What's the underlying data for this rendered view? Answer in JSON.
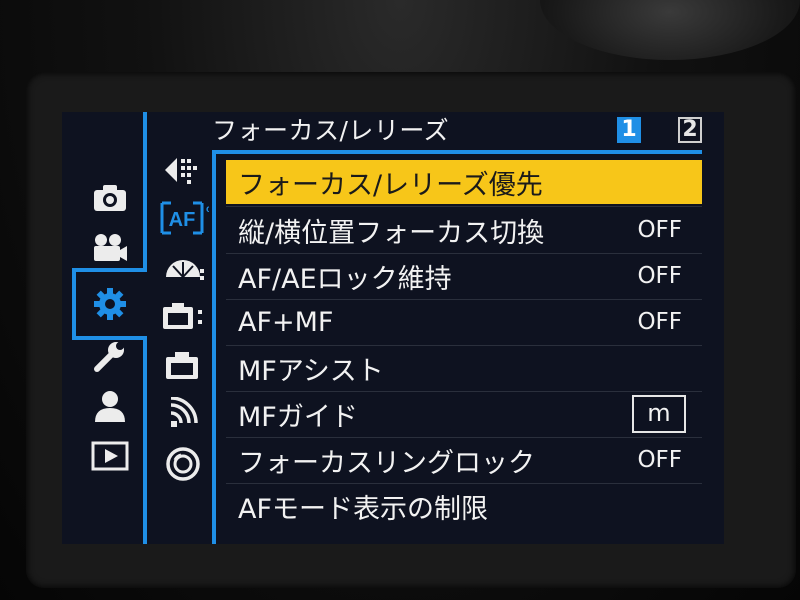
{
  "menu": {
    "title": "フォーカス/レリーズ",
    "pages": [
      "1",
      "2"
    ],
    "active_page": "1",
    "items": [
      {
        "label": "フォーカス/レリーズ優先",
        "value": "",
        "selected": true
      },
      {
        "label": "縦/横位置フォーカス切換",
        "value": "OFF"
      },
      {
        "label": "AF/AEロック維持",
        "value": "OFF"
      },
      {
        "label": "AF+MF",
        "value": "OFF"
      },
      {
        "label": "MFアシスト",
        "value": ""
      },
      {
        "label": "MFガイド",
        "value": "m"
      },
      {
        "label": "フォーカスリングロック",
        "value": "OFF"
      },
      {
        "label": "AFモード表示の制限",
        "value": ""
      }
    ]
  },
  "main_tabs": [
    {
      "icon": "camera-icon"
    },
    {
      "icon": "movie-camera-icon"
    },
    {
      "icon": "gear-icon",
      "active": true
    },
    {
      "icon": "wrench-icon"
    },
    {
      "icon": "person-icon"
    },
    {
      "icon": "playback-icon"
    }
  ],
  "sub_tabs": [
    {
      "icon": "custom-sliders-icon"
    },
    {
      "icon": "af-icon",
      "label": "AF"
    },
    {
      "icon": "exposure-meter-icon"
    },
    {
      "icon": "camera-settings-icon"
    },
    {
      "icon": "camera-outline-icon"
    },
    {
      "icon": "wireless-icon"
    },
    {
      "icon": "lens-icon"
    }
  ],
  "colors": {
    "accent": "#1f8fe6",
    "highlight": "#f7c619",
    "background": "#0e1220",
    "text": "#f2f2f2"
  }
}
